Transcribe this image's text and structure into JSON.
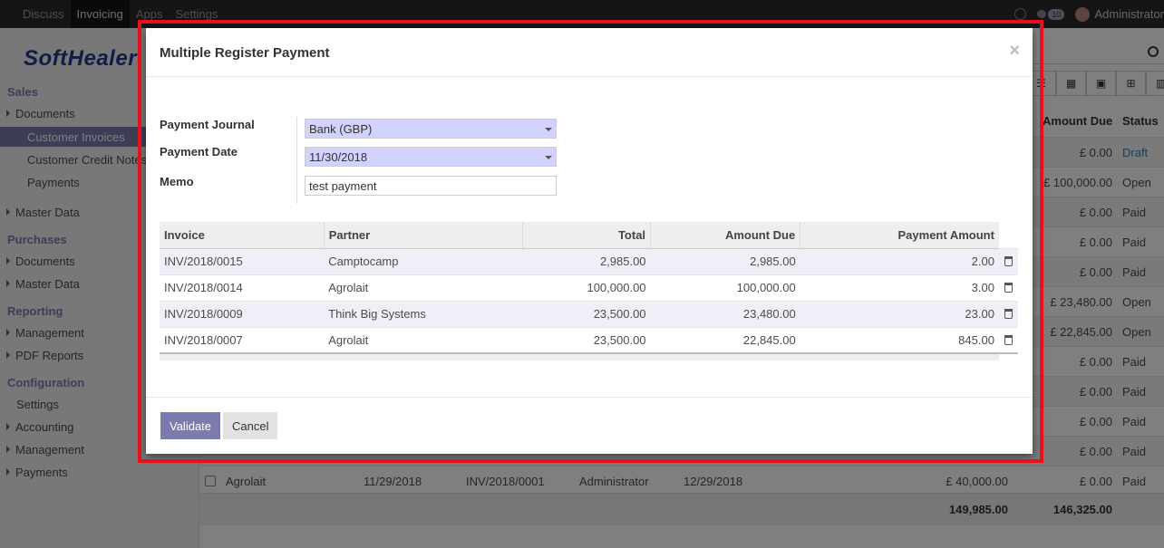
{
  "topbar": {
    "menu": [
      "Discuss",
      "Invoicing",
      "Apps",
      "Settings"
    ],
    "active": "Invoicing",
    "chat_count": "10",
    "user": "Administrator"
  },
  "sidebar": {
    "logo": "SoftHealer",
    "sections": [
      {
        "title": "Sales",
        "items": [
          {
            "label": "Documents",
            "caret": true
          },
          {
            "label": "Customer Invoices",
            "selected": true
          },
          {
            "label": "Customer Credit Notes"
          },
          {
            "label": "Payments"
          },
          {
            "label": "Master Data",
            "caret": true
          }
        ]
      },
      {
        "title": "Purchases",
        "items": [
          {
            "label": "Documents",
            "caret": true
          },
          {
            "label": "Master Data",
            "caret": true
          }
        ]
      },
      {
        "title": "Reporting",
        "items": [
          {
            "label": "Management",
            "caret": true
          },
          {
            "label": "PDF Reports",
            "caret": true
          }
        ]
      },
      {
        "title": "Configuration",
        "items": [
          {
            "label": "Settings"
          },
          {
            "label": "Accounting",
            "caret": true
          },
          {
            "label": "Management",
            "caret": true
          },
          {
            "label": "Payments",
            "caret": true
          }
        ]
      }
    ]
  },
  "background_list": {
    "headers": {
      "amount_due": "Amount Due",
      "status": "Status"
    },
    "rows": [
      {
        "amount_due": "£ 0.00",
        "status": "Draft"
      },
      {
        "amount_due": "£ 100,000.00",
        "status": "Open"
      },
      {
        "amount_due": "£ 0.00",
        "status": "Paid"
      },
      {
        "amount_due": "£ 0.00",
        "status": "Paid"
      },
      {
        "amount_due": "£ 0.00",
        "status": "Paid"
      },
      {
        "amount_due": "£ 23,480.00",
        "status": "Open"
      },
      {
        "amount_due": "£ 22,845.00",
        "status": "Open"
      },
      {
        "amount_due": "£ 0.00",
        "status": "Paid"
      },
      {
        "amount_due": "£ 0.00",
        "status": "Paid"
      },
      {
        "amount_due": "£ 0.00",
        "status": "Paid"
      },
      {
        "amount_due": "£ 0.00",
        "status": "Paid"
      }
    ],
    "last_row": {
      "customer": "Agrolait",
      "invoice_date": "11/29/2018",
      "number": "INV/2018/0001",
      "salesperson": "Administrator",
      "due_date": "12/29/2018",
      "total": "£ 40,000.00",
      "amount_due": "£ 0.00",
      "status": "Paid"
    },
    "totals": {
      "total": "149,985.00",
      "amount_due": "146,325.00"
    }
  },
  "modal": {
    "title": "Multiple Register Payment",
    "close": "×",
    "journal_label": "Payment Journal",
    "journal_value": "Bank (GBP)",
    "date_label": "Payment Date",
    "date_value": "11/30/2018",
    "memo_label": "Memo",
    "memo_value": "test payment",
    "columns": [
      "Invoice",
      "Partner",
      "Total",
      "Amount Due",
      "Payment Amount"
    ],
    "lines": [
      {
        "invoice": "INV/2018/0015",
        "partner": "Camptocamp",
        "total": "2,985.00",
        "amount_due": "2,985.00",
        "payment": "2.00"
      },
      {
        "invoice": "INV/2018/0014",
        "partner": "Agrolait",
        "total": "100,000.00",
        "amount_due": "100,000.00",
        "payment": "3.00"
      },
      {
        "invoice": "INV/2018/0009",
        "partner": "Think Big Systems",
        "total": "23,500.00",
        "amount_due": "23,480.00",
        "payment": "23.00"
      },
      {
        "invoice": "INV/2018/0007",
        "partner": "Agrolait",
        "total": "23,500.00",
        "amount_due": "22,845.00",
        "payment": "845.00"
      }
    ],
    "validate_label": "Validate",
    "cancel_label": "Cancel"
  },
  "colors": {
    "accent": "#7c7bad",
    "highlight": "#e8101a",
    "required_field": "#d2d2ff"
  }
}
